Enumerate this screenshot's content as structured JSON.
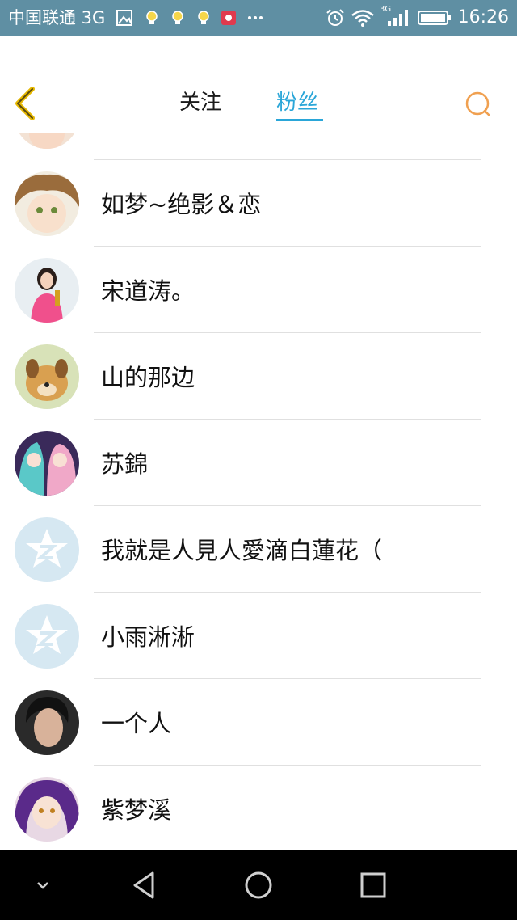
{
  "status_bar": {
    "carrier": "中国联通 3G",
    "network_badge": "3G",
    "time": "16:26",
    "icons": [
      "image-icon",
      "lightbulb-icon",
      "lightbulb-icon",
      "lightbulb-icon",
      "huawei-app-icon",
      "more-dots-icon",
      "alarm-icon",
      "wifi-icon",
      "signal-icon",
      "battery-icon"
    ]
  },
  "header": {
    "tabs": [
      {
        "label": "关注",
        "active": false
      },
      {
        "label": "粉丝",
        "active": true
      }
    ],
    "back_icon": "chevron-left-icon",
    "search_icon": "search-icon",
    "accent_color": "#2aa6d8",
    "back_color": "#e6b800",
    "search_color": "#f0a050"
  },
  "fans": [
    {
      "name": "",
      "avatar": "anime-girl-avatar"
    },
    {
      "name": "如梦~绝影＆恋",
      "avatar": "anime-boy-avatar"
    },
    {
      "name": "宋道涛。",
      "avatar": "woman-pink-avatar"
    },
    {
      "name": "山的那边",
      "avatar": "cartoon-dog-avatar"
    },
    {
      "name": "苏錦",
      "avatar": "anime-couple-avatar"
    },
    {
      "name": "我就是人見人愛滴白蓮花（",
      "avatar": "default-qzone-avatar"
    },
    {
      "name": "小雨淅淅",
      "avatar": "default-qzone-avatar"
    },
    {
      "name": "一个人",
      "avatar": "man-portrait-avatar"
    },
    {
      "name": "紫梦溪",
      "avatar": "anime-purple-hair-avatar"
    }
  ],
  "nav_bar": {
    "buttons": [
      "chevron-down-icon",
      "back-triangle-icon",
      "home-circle-icon",
      "recents-square-icon"
    ]
  }
}
